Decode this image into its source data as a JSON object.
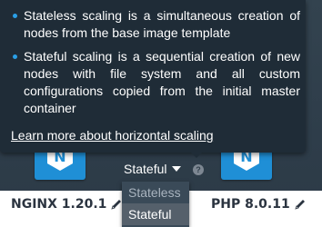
{
  "tooltip": {
    "items": [
      "Stateless scaling is a simultaneous creation of nodes from the base image template",
      "Stateful scaling is a sequential creation of new nodes with file system and all custom configurations copied from the initial master container"
    ],
    "learn_more_link": "Learn more about horizontal scaling"
  },
  "scaling_mode": {
    "selected": "Stateful",
    "options": [
      "Stateless",
      "Stateful"
    ]
  },
  "nodes": [
    {
      "label": "NGINX 1.20.1",
      "icon": "nginx-logo",
      "letter": "N"
    },
    {
      "label": "PHP 8.0.11",
      "icon": "nginx-logo",
      "letter": "N"
    }
  ],
  "colors": {
    "tile": "#1f8fd6",
    "tooltip_bg": "#1f2c37",
    "bullet": "#2a9fe6"
  }
}
